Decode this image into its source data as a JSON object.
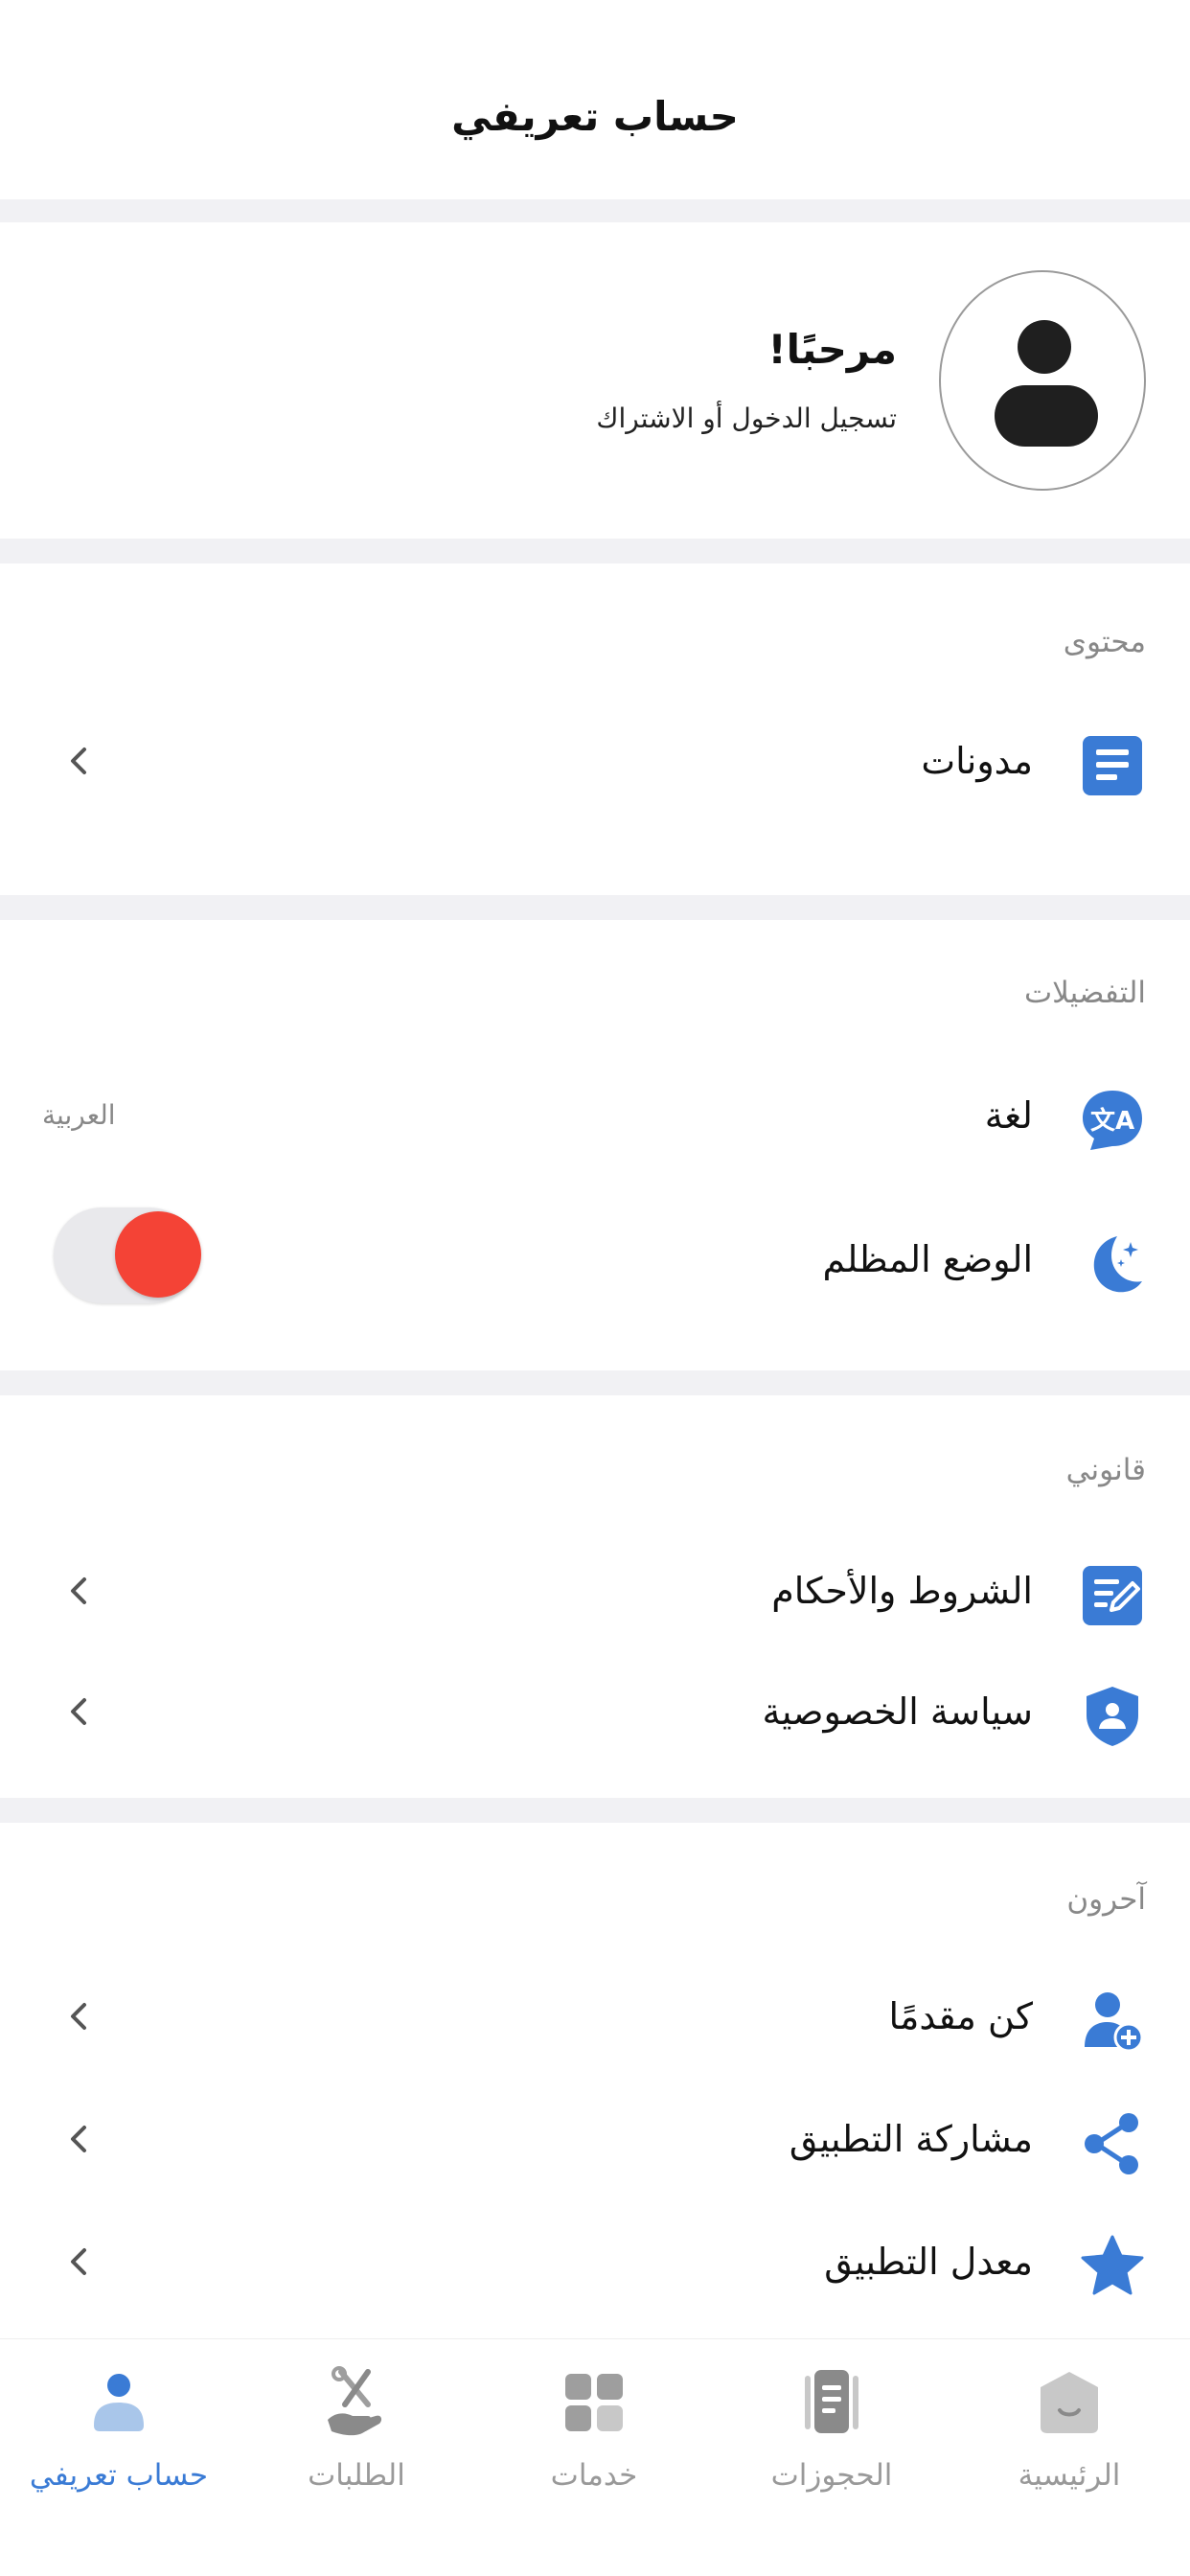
{
  "header": {
    "title": "حساب تعريفي"
  },
  "profile": {
    "greeting": "مرحبًا!",
    "subtitle": "تسجيل الدخول أو الاشتراك",
    "avatar_icon": "user-silhouette-icon"
  },
  "sections": {
    "content": {
      "title": "محتوى",
      "items": [
        {
          "label": "مدونات",
          "icon": "document-icon"
        }
      ]
    },
    "preferences": {
      "title": "التفضيلات",
      "language": {
        "label": "لغة",
        "value": "العربية",
        "icon": "translate-icon"
      },
      "dark_mode": {
        "label": "الوضع المظلم",
        "icon": "moon-icon",
        "on": true
      }
    },
    "legal": {
      "title": "قانوني",
      "items": [
        {
          "label": "الشروط والأحكام",
          "icon": "edit-document-icon"
        },
        {
          "label": "سياسة الخصوصية",
          "icon": "shield-user-icon"
        }
      ]
    },
    "others": {
      "title": "آحرون",
      "items": [
        {
          "label": "كن مقدمًا",
          "icon": "add-user-icon"
        },
        {
          "label": "مشاركة التطبيق",
          "icon": "share-icon"
        },
        {
          "label": "معدل التطبيق",
          "icon": "star-icon"
        }
      ]
    }
  },
  "bottom_nav": {
    "items": [
      {
        "label": "حساب تعريفي",
        "icon": "person-icon",
        "active": true
      },
      {
        "label": "الطلبات",
        "icon": "tools-hand-icon",
        "active": false
      },
      {
        "label": "خدمات",
        "icon": "grid-icon",
        "active": false
      },
      {
        "label": "الحجوزات",
        "icon": "clipboard-icon",
        "active": false
      },
      {
        "label": "الرئيسية",
        "icon": "home-icon",
        "active": false
      }
    ]
  },
  "colors": {
    "accent": "#3a7bd5",
    "toggle_on": "#f44336",
    "separator": "#f1f1f4",
    "muted_text": "#888888"
  }
}
